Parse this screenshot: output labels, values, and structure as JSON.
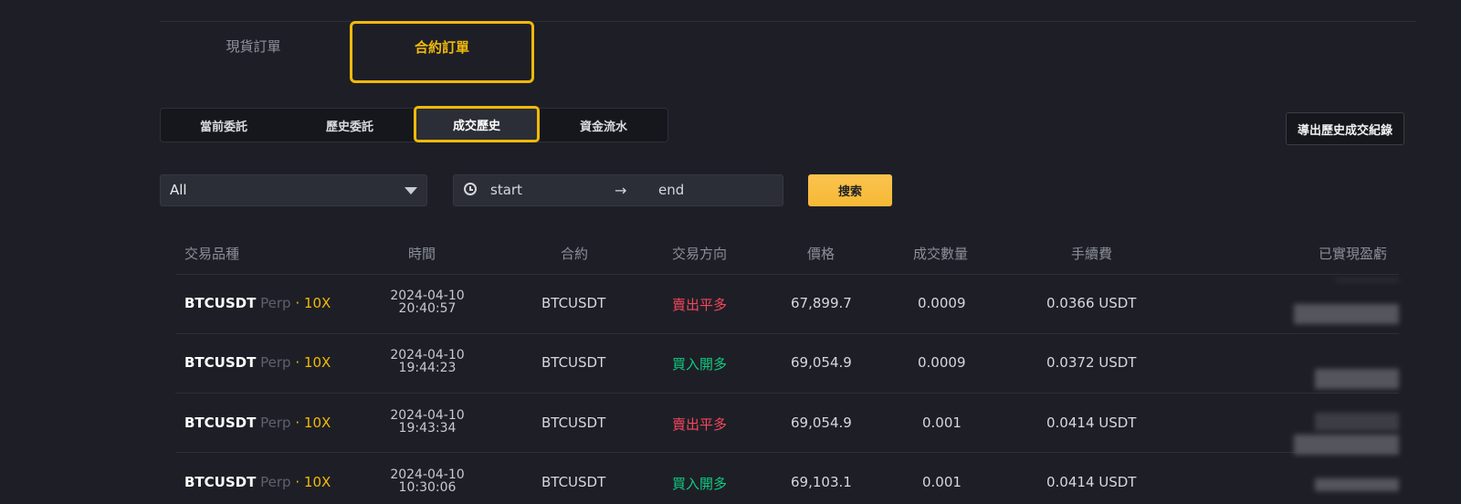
{
  "tabs": {
    "spot": "現貨訂單",
    "futures": "合約訂單"
  },
  "subtabs": [
    "當前委託",
    "歷史委託",
    "成交歷史",
    "資金流水"
  ],
  "export_label": "導出歷史成交紀錄",
  "filter": {
    "symbol_value": "All",
    "start_placeholder": "start",
    "arrow": "→",
    "end_placeholder": "end",
    "search_label": "搜索"
  },
  "table": {
    "headers": [
      "交易品種",
      "時間",
      "合約",
      "交易方向",
      "價格",
      "成交數量",
      "手續費",
      "已實現盈虧"
    ],
    "rows": [
      {
        "symbol": "BTCUSDT",
        "perp": "Perp",
        "sep": "·",
        "leverage": "10X",
        "date": "2024-04-10",
        "time": "20:40:57",
        "contract": "BTCUSDT",
        "side": "賣出平多",
        "side_type": "sell",
        "price": "67,899.7",
        "qty": "0.0009",
        "fee": "0.0366 USDT"
      },
      {
        "symbol": "BTCUSDT",
        "perp": "Perp",
        "sep": "·",
        "leverage": "10X",
        "date": "2024-04-10",
        "time": "19:44:23",
        "contract": "BTCUSDT",
        "side": "買入開多",
        "side_type": "buy",
        "price": "69,054.9",
        "qty": "0.0009",
        "fee": "0.0372 USDT"
      },
      {
        "symbol": "BTCUSDT",
        "perp": "Perp",
        "sep": "·",
        "leverage": "10X",
        "date": "2024-04-10",
        "time": "19:43:34",
        "contract": "BTCUSDT",
        "side": "賣出平多",
        "side_type": "sell",
        "price": "69,054.9",
        "qty": "0.001",
        "fee": "0.0414 USDT"
      },
      {
        "symbol": "BTCUSDT",
        "perp": "Perp",
        "sep": "·",
        "leverage": "10X",
        "date": "2024-04-10",
        "time": "10:30:06",
        "contract": "BTCUSDT",
        "side": "買入開多",
        "side_type": "buy",
        "price": "69,103.1",
        "qty": "0.001",
        "fee": "0.0414 USDT"
      }
    ]
  },
  "colors": {
    "accent": "#f0b90b",
    "sell": "#f6465d",
    "buy": "#0ecb81",
    "background": "#1e1f26"
  }
}
